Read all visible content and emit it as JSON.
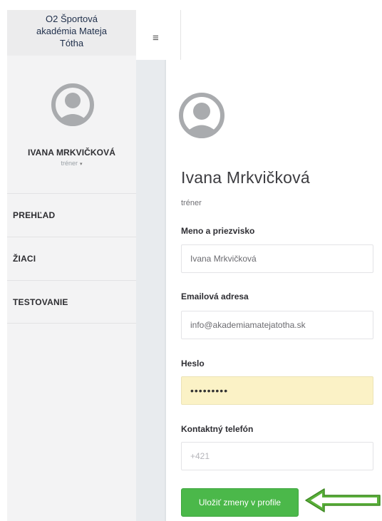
{
  "brand": {
    "lines": [
      "O2 Športová",
      "akadémia Mateja",
      "Tótha"
    ]
  },
  "sidebar": {
    "user_name": "IVANA MRKVIČKOVÁ",
    "user_role": "tréner",
    "role_caret": "▾",
    "nav": [
      {
        "label": "PREHĽAD"
      },
      {
        "label": "ŽIACI"
      },
      {
        "label": "TESTOVANIE"
      }
    ]
  },
  "topbar": {
    "menu_glyph": "≡"
  },
  "profile": {
    "name": "Ivana Mrkvičková",
    "role": "tréner",
    "fields": {
      "name_label": "Meno a priezvisko",
      "name_value": "Ivana Mrkvičková",
      "email_label": "Emailová adresa",
      "email_value": "info@akademiamatejatotha.sk",
      "password_label": "Heslo",
      "password_value": "•••••••••",
      "phone_label": "Kontaktný telefón",
      "phone_placeholder": "+421"
    },
    "save_label": "Uložiť zmeny v profile"
  },
  "colors": {
    "accent_green": "#4bb84a",
    "arrow_green": "#5ab03a",
    "password_highlight": "#fbf2c6",
    "sidebar_bg": "#f3f3f4"
  },
  "icons": {
    "avatar": "user-avatar-icon",
    "menu": "hamburger-icon",
    "pointer": "arrow-left-icon"
  }
}
